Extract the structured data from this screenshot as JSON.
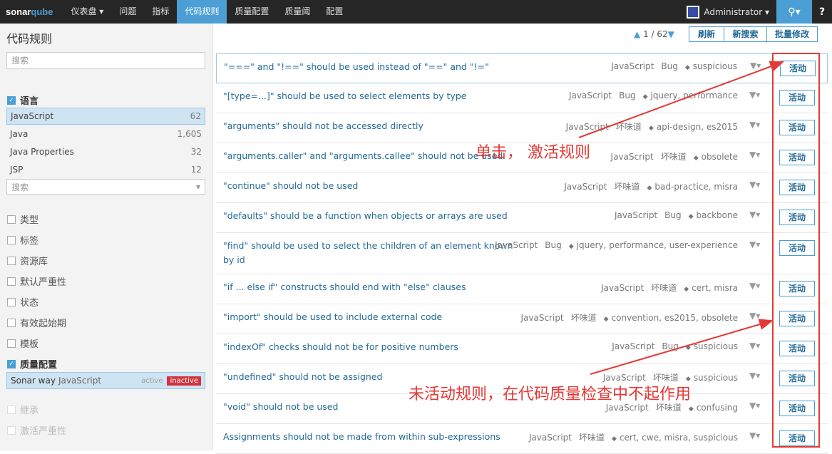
{
  "nav": {
    "logo_main": "sonar",
    "logo_accent": "qube",
    "items": [
      {
        "label": "仪表盘 ▾"
      },
      {
        "label": "问题"
      },
      {
        "label": "指标"
      },
      {
        "label": "代码规则",
        "active": true
      },
      {
        "label": "质量配置"
      },
      {
        "label": "质量阈"
      },
      {
        "label": "配置"
      }
    ],
    "user": "Administrator ▾",
    "help": "?"
  },
  "sidebar": {
    "title": "代码规则",
    "search_placeholder": "搜索",
    "language_head": "语言",
    "languages": [
      {
        "name": "JavaScript",
        "count": "62"
      },
      {
        "name": "Java",
        "count": "1,605"
      },
      {
        "name": "Java Properties",
        "count": "32"
      },
      {
        "name": "JSP",
        "count": "12"
      }
    ],
    "lang_search": "搜索",
    "facets": [
      "类型",
      "标签",
      "资源库",
      "默认严重性",
      "状态",
      "有效起始期",
      "模板"
    ],
    "qp_head": "质量配置",
    "qp": {
      "name": "Sonar way",
      "lang": "JavaScript",
      "active": "active",
      "inactive": "inactive"
    },
    "disabled_facets": [
      "继承",
      "激活严重性"
    ]
  },
  "toolbar": {
    "pager": "1 / 62",
    "refresh": "刷新",
    "new_search": "新搜索",
    "bulk": "批量修改"
  },
  "rules": [
    {
      "title": "\"===\" and \"!==\" should be used instead of \"==\" and \"!=\"",
      "lang": "JavaScript",
      "type": "Bug",
      "tags": "suspicious"
    },
    {
      "title": "\"[type=...]\" should be used to select elements by type",
      "lang": "JavaScript",
      "type": "Bug",
      "tags": "jquery, performance"
    },
    {
      "title": "\"arguments\" should not be accessed directly",
      "lang": "JavaScript",
      "type": "坏味道",
      "tags": "api-design, es2015"
    },
    {
      "title": "\"arguments.caller\" and \"arguments.callee\" should not be used",
      "lang": "JavaScript",
      "type": "坏味道",
      "tags": "obsolete"
    },
    {
      "title": "\"continue\" should not be used",
      "lang": "JavaScript",
      "type": "坏味道",
      "tags": "bad-practice, misra"
    },
    {
      "title": "\"defaults\" should be a function when objects or arrays are used",
      "lang": "JavaScript",
      "type": "Bug",
      "tags": "backbone"
    },
    {
      "title": "\"find\" should be used to select the children of an element known",
      "title2": "by id",
      "lang": "JavaScript",
      "type": "Bug",
      "tags": "jquery, performance, user-experience"
    },
    {
      "title": "\"if ... else if\" constructs should end with \"else\" clauses",
      "lang": "JavaScript",
      "type": "坏味道",
      "tags": "cert, misra"
    },
    {
      "title": "\"import\" should be used to include external code",
      "lang": "JavaScript",
      "type": "坏味道",
      "tags": "convention, es2015, obsolete"
    },
    {
      "title": "\"indexOf\" checks should not be for positive numbers",
      "lang": "JavaScript",
      "type": "Bug",
      "tags": "suspicious"
    },
    {
      "title": "\"undefined\" should not be assigned",
      "lang": "JavaScript",
      "type": "坏味道",
      "tags": "suspicious"
    },
    {
      "title": "\"void\" should not be used",
      "lang": "JavaScript",
      "type": "坏味道",
      "tags": "confusing"
    },
    {
      "title": "Assignments should not be made from within sub-expressions",
      "lang": "JavaScript",
      "type": "坏味道",
      "tags": "cert, cwe, misra, suspicious"
    }
  ],
  "activate_label": "活动",
  "annotations": {
    "click": "单击，  激活规则",
    "inactive": "未活动规则，在代码质量检查中不起作用"
  },
  "colors": {
    "accent": "#4b9fd5",
    "annotation": "#e53935",
    "nav_bg": "#262626"
  }
}
